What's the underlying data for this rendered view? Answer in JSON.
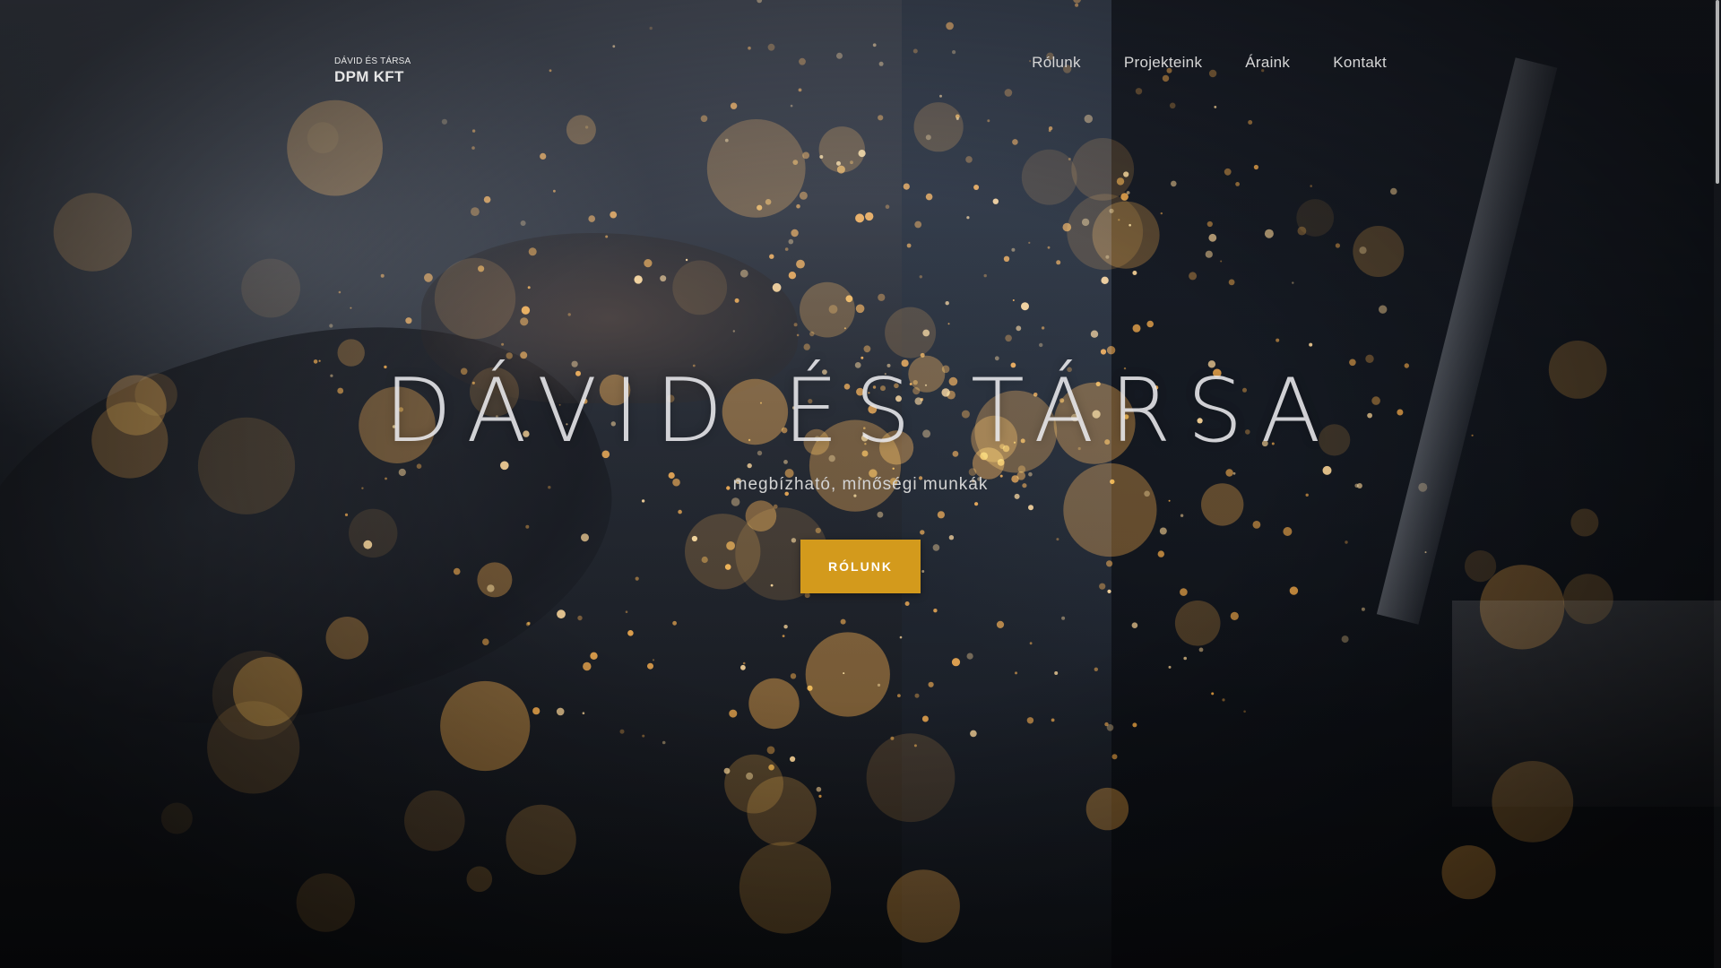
{
  "logo": {
    "small": "DÁVID ÉS TÁRSA",
    "big": "DPM KFT"
  },
  "nav": {
    "items": [
      {
        "label": "Rólunk"
      },
      {
        "label": "Projekteink"
      },
      {
        "label": "Áraink"
      },
      {
        "label": "Kontakt"
      }
    ]
  },
  "hero": {
    "title": "DÁVID ÉS TÁRSA",
    "subtitle": "megbízható, minőségi munkák",
    "button_label": "RÓLUNK"
  },
  "colors": {
    "accent": "#d39a1c",
    "background": "#0e1116",
    "spark": "#f0a030"
  }
}
